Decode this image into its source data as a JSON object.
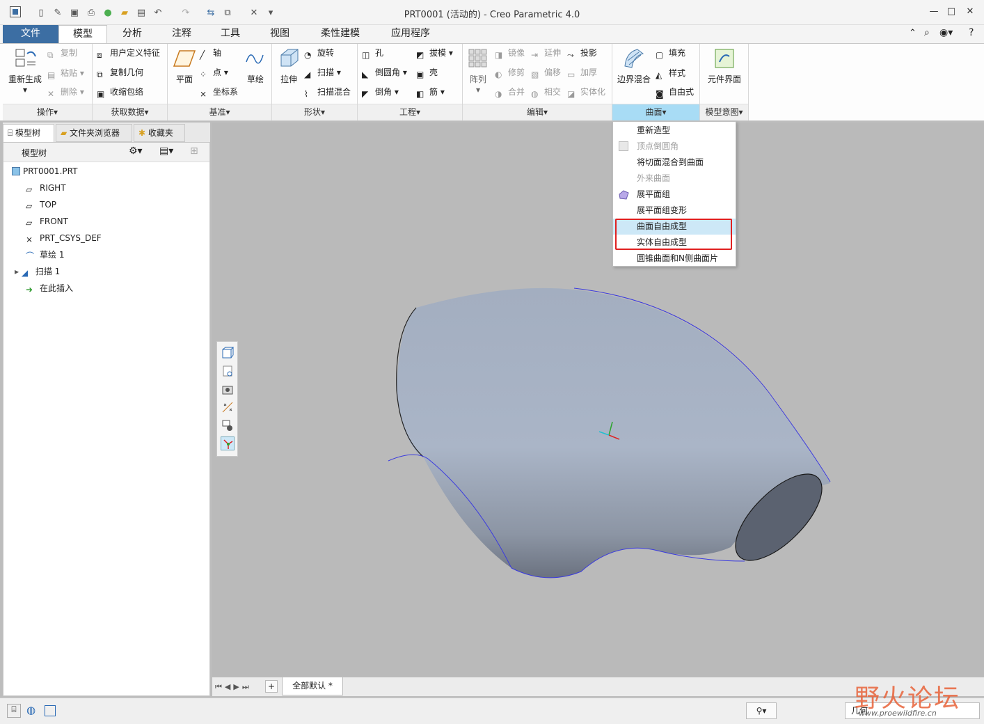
{
  "window": {
    "title": "PRT0001 (活动的) - Creo Parametric 4.0"
  },
  "tabs": [
    "文件",
    "模型",
    "分析",
    "注释",
    "工具",
    "视图",
    "柔性建模",
    "应用程序"
  ],
  "ribbon": {
    "operations": {
      "big": "重新生成",
      "items": [
        "复制",
        "粘贴",
        "删除"
      ],
      "label": "操作"
    },
    "get_data": {
      "items": [
        "用户定义特征",
        "复制几何",
        "收缩包络"
      ],
      "label": "获取数据"
    },
    "datum": {
      "plane": "平面",
      "items": [
        "轴",
        "点",
        "坐标系"
      ],
      "sketch": "草绘",
      "label": "基准"
    },
    "shapes": {
      "big": "拉伸",
      "items": [
        "旋转",
        "扫描",
        "扫描混合"
      ],
      "label": "形状"
    },
    "engineering": {
      "col1": [
        "孔",
        "倒圆角",
        "倒角"
      ],
      "col2": [
        "拔模",
        "壳",
        "筋"
      ],
      "label": "工程"
    },
    "editing": {
      "big": "阵列",
      "col1": [
        "镜像",
        "修剪",
        "合并"
      ],
      "col2": [
        "延伸",
        "偏移",
        "相交"
      ],
      "col3": [
        "投影",
        "加厚",
        "实体化"
      ],
      "label": "编辑"
    },
    "surfaces": {
      "big": "边界混合",
      "items": [
        "填充",
        "样式",
        "自由式"
      ],
      "label": "曲面"
    },
    "model_intent": {
      "big": "元件界面",
      "label": "模型意图"
    }
  },
  "surfaces_menu": {
    "items": [
      {
        "label": "重新造型",
        "enabled": true
      },
      {
        "label": "顶点倒圆角",
        "enabled": false
      },
      {
        "label": "将切面混合到曲面",
        "enabled": true
      },
      {
        "label": "外来曲面",
        "enabled": false
      },
      {
        "label": "展平面组",
        "enabled": true
      },
      {
        "label": "展平面组变形",
        "enabled": true
      },
      {
        "label": "曲面自由成型",
        "enabled": true
      },
      {
        "label": "实体自由成型",
        "enabled": true
      },
      {
        "label": "圆锥曲面和N侧曲面片",
        "enabled": true
      }
    ]
  },
  "left_panel": {
    "tabs": [
      "模型树",
      "文件夹浏览器",
      "收藏夹"
    ],
    "tree_header": "模型树",
    "tree": [
      "PRT0001.PRT",
      "RIGHT",
      "TOP",
      "FRONT",
      "PRT_CSYS_DEF",
      "草绘 1",
      "扫描 1",
      "在此插入"
    ]
  },
  "bottom": {
    "tab": "全部默认 *"
  },
  "status": {
    "filter": "几何"
  },
  "watermark": {
    "text": "野火论坛",
    "url": "www.proewildfire.cn"
  },
  "colors": {
    "file_tab": "#3c6ea3",
    "selected_group": "#a8dcf5",
    "highlight": "#e02020",
    "part": "#a9b4c6"
  }
}
